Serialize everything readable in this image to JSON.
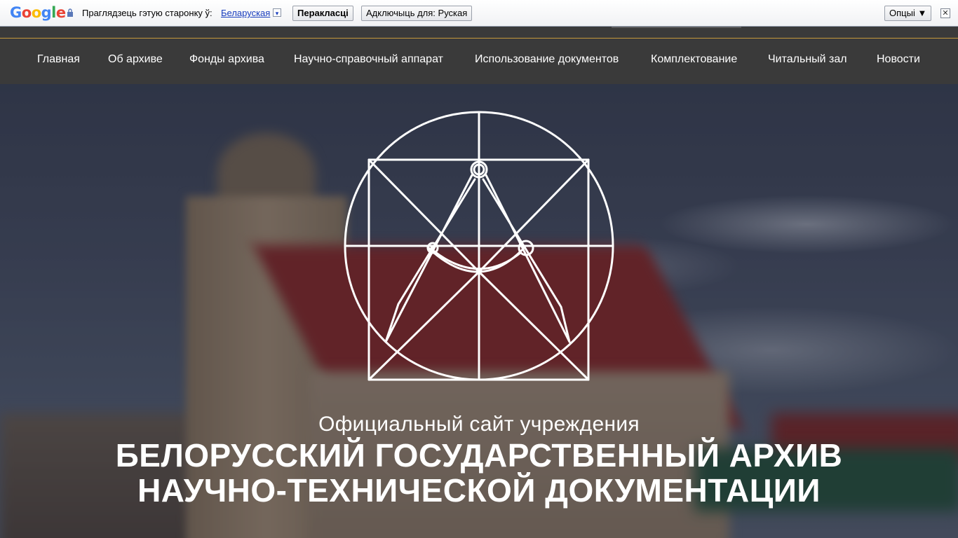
{
  "translate_bar": {
    "logo_letters": [
      "G",
      "o",
      "o",
      "g",
      "l",
      "e"
    ],
    "prompt_text": "Праглядзець гэтую старонку ў:",
    "target_language": "Беларуская",
    "translate_button": "Перакласці",
    "disable_button": "Адключыць для: Руская",
    "options_button": "Опцыі ▼",
    "close_symbol": "✕",
    "lang_arrow": "▾"
  },
  "nav": {
    "items": [
      {
        "label": "Главная"
      },
      {
        "label": "Об архиве"
      },
      {
        "label": "Фонды архива"
      },
      {
        "label": "Научно-справочный аппарат"
      },
      {
        "label": "Использование документов"
      },
      {
        "label": "Комплектование"
      },
      {
        "label": "Читальный зал"
      },
      {
        "label": "Новости"
      }
    ]
  },
  "hero": {
    "subtitle": "Официальный сайт учреждения",
    "title_line1": "БЕЛОРУССКИЙ ГОСУДАРСТВЕННЫЙ АРХИВ",
    "title_line2": "НАУЧНО-ТЕХНИЧЕСКОЙ ДОКУМЕНТАЦИИ"
  },
  "colors": {
    "nav_bg": "#3a3a3a",
    "accent_line": "#c79a3c",
    "emblem_stroke": "#ffffff"
  }
}
